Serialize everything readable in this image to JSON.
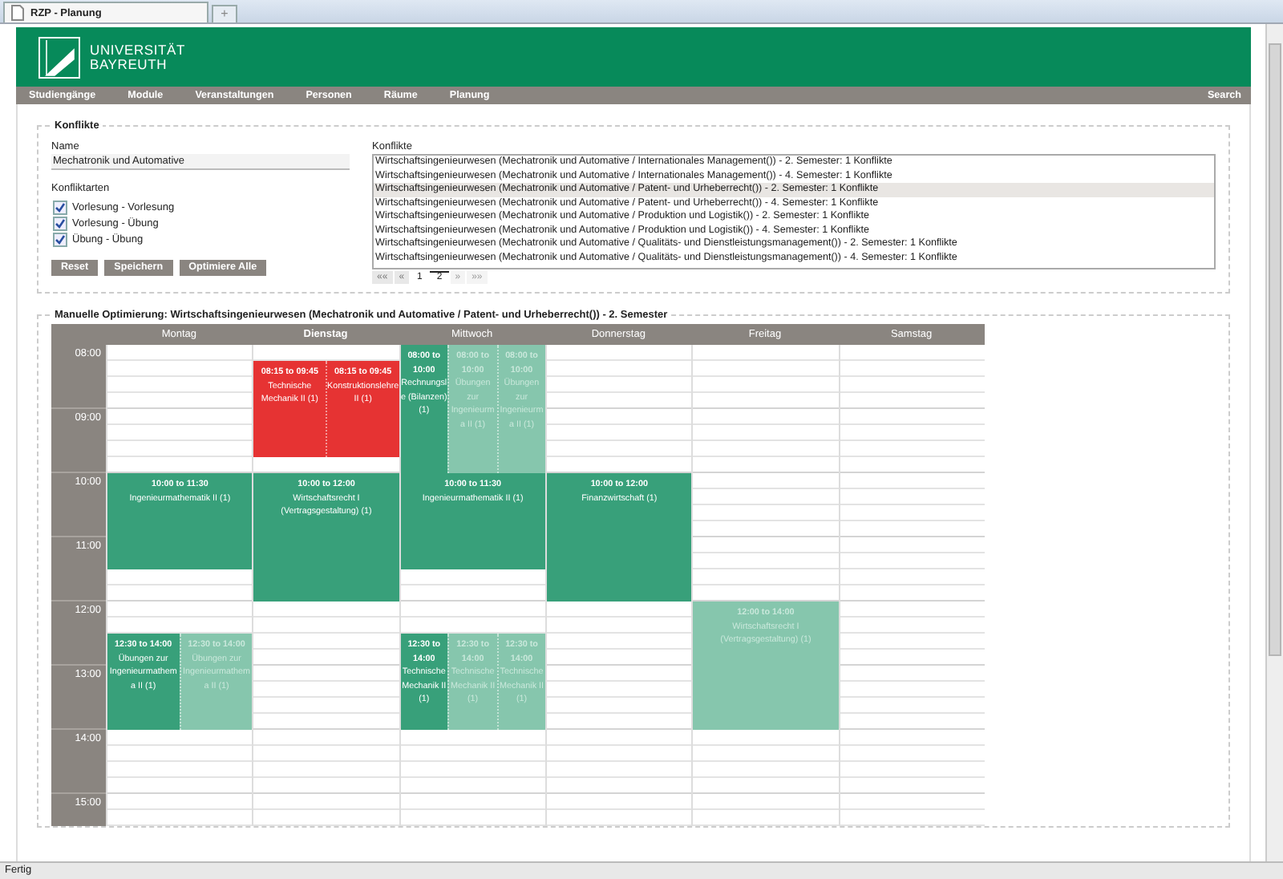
{
  "browser": {
    "tab_title": "RZP - Planung",
    "new_tab": "+"
  },
  "header": {
    "logo_lines": [
      "UNIVERSITÄT",
      "BAYREUTH"
    ]
  },
  "nav": {
    "items": [
      "Studiengänge",
      "Module",
      "Veranstaltungen",
      "Personen",
      "Räume",
      "Planung"
    ],
    "search": "Search"
  },
  "conflicts": {
    "legend": "Konflikte",
    "name_label": "Name",
    "name_value": "Mechatronik und Automative",
    "types_label": "Konfliktarten",
    "types": [
      {
        "label": "Vorlesung - Vorlesung",
        "checked": true
      },
      {
        "label": "Vorlesung - Übung",
        "checked": true
      },
      {
        "label": "Übung - Übung",
        "checked": true
      }
    ],
    "buttons": [
      "Reset",
      "Speichern",
      "Optimiere Alle"
    ],
    "list_label": "Konflikte",
    "list": [
      {
        "text": "Wirtschaftsingenieurwesen (Mechatronik und Automative / Internationales Management()) - 2. Semester: 1 Konflikte",
        "selected": false
      },
      {
        "text": "Wirtschaftsingenieurwesen (Mechatronik und Automative / Internationales Management()) - 4. Semester: 1 Konflikte",
        "selected": false
      },
      {
        "text": "Wirtschaftsingenieurwesen (Mechatronik und Automative / Patent- und Urheberrecht()) - 2. Semester: 1 Konflikte",
        "selected": true
      },
      {
        "text": "Wirtschaftsingenieurwesen (Mechatronik und Automative / Patent- und Urheberrecht()) - 4. Semester: 1 Konflikte",
        "selected": false
      },
      {
        "text": "Wirtschaftsingenieurwesen (Mechatronik und Automative / Produktion und Logistik()) - 2. Semester: 1 Konflikte",
        "selected": false
      },
      {
        "text": "Wirtschaftsingenieurwesen (Mechatronik und Automative / Produktion und Logistik()) - 4. Semester: 1 Konflikte",
        "selected": false
      },
      {
        "text": "Wirtschaftsingenieurwesen (Mechatronik und Automative / Qualitäts- und Dienstleistungsmanagement()) - 2. Semester: 1 Konflikte",
        "selected": false
      },
      {
        "text": "Wirtschaftsingenieurwesen (Mechatronik und Automative / Qualitäts- und Dienstleistungsmanagement()) - 4. Semester: 1 Konflikte",
        "selected": false
      }
    ],
    "pager": [
      {
        "label": "««",
        "kind": "nav",
        "selected": false,
        "disabled": false
      },
      {
        "label": "«",
        "kind": "nav",
        "selected": false,
        "disabled": false
      },
      {
        "label": "1",
        "kind": "page",
        "selected": false,
        "disabled": false
      },
      {
        "label": "2",
        "kind": "page",
        "selected": true,
        "disabled": false
      },
      {
        "label": "»",
        "kind": "nav",
        "selected": false,
        "disabled": true
      },
      {
        "label": "»»",
        "kind": "nav",
        "selected": false,
        "disabled": true
      }
    ]
  },
  "calendar": {
    "legend": "Manuelle Optimierung: Wirtschaftsingenieurwesen (Mechatronik und Automative / Patent- und Urheberrecht()) - 2. Semester",
    "hours": [
      "08:00",
      "09:00",
      "10:00",
      "11:00",
      "12:00",
      "13:00",
      "14:00",
      "15:00"
    ],
    "days": [
      {
        "name": "Montag",
        "today": false,
        "slots": [
          {
            "entries": [
              {
                "time": "10:00 to 11:30",
                "title": "Ingenieurmathematik II (1)",
                "kind": "scheduled"
              }
            ]
          },
          {
            "entries": [
              {
                "time": "12:30 to 14:00",
                "title": "Übungen zur Ingenieurmathema II (1)",
                "kind": "scheduled"
              },
              {
                "time": "12:30 to 14:00",
                "title": "Übungen zur Ingenieurmathema II (1)",
                "kind": "alternative"
              }
            ]
          }
        ]
      },
      {
        "name": "Dienstag",
        "today": true,
        "slots": [
          {
            "entries": [
              {
                "time": "08:15 to 09:45",
                "title": "Technische Mechanik II (1)",
                "kind": "conflict"
              },
              {
                "time": "08:15 to 09:45",
                "title": "Konstruktionslehre II (1)",
                "kind": "conflict"
              }
            ]
          },
          {
            "entries": [
              {
                "time": "10:00 to 12:00",
                "title": "Wirtschaftsrecht I (Vertragsgestaltung) (1)",
                "kind": "scheduled"
              }
            ]
          }
        ]
      },
      {
        "name": "Mittwoch",
        "today": false,
        "slots": [
          {
            "entries": [
              {
                "time": "08:00 to 10:00",
                "title": "Rechnungsle (Bilanzen) (1)",
                "kind": "scheduled"
              },
              {
                "time": "08:00 to 10:00",
                "title": "Übungen zur Ingenieurma II (1)",
                "kind": "alternative"
              },
              {
                "time": "08:00 to 10:00",
                "title": "Übungen zur Ingenieurma II (1)",
                "kind": "alternative"
              }
            ]
          },
          {
            "entries": [
              {
                "time": "10:00 to 11:30",
                "title": "Ingenieurmathematik II (1)",
                "kind": "scheduled"
              }
            ]
          },
          {
            "entries": [
              {
                "time": "12:30 to 14:00",
                "title": "Technische Mechanik II (1)",
                "kind": "scheduled"
              },
              {
                "time": "12:30 to 14:00",
                "title": "Technische Mechanik II (1)",
                "kind": "alternative"
              },
              {
                "time": "12:30 to 14:00",
                "title": "Technische Mechanik II (1)",
                "kind": "alternative"
              }
            ]
          }
        ]
      },
      {
        "name": "Donnerstag",
        "today": false,
        "slots": [
          {
            "entries": [
              {
                "time": "10:00 to 12:00",
                "title": "Finanzwirtschaft (1)",
                "kind": "scheduled"
              }
            ]
          }
        ]
      },
      {
        "name": "Freitag",
        "today": false,
        "slots": [
          {
            "entries": [
              {
                "time": "12:00 to 14:00",
                "title": "Wirtschaftsrecht I (Vertragsgestaltung) (1)",
                "kind": "alternative"
              }
            ]
          }
        ]
      },
      {
        "name": "Samstag",
        "today": false
      }
    ]
  },
  "status_bar": {
    "text": "Fertig"
  }
}
